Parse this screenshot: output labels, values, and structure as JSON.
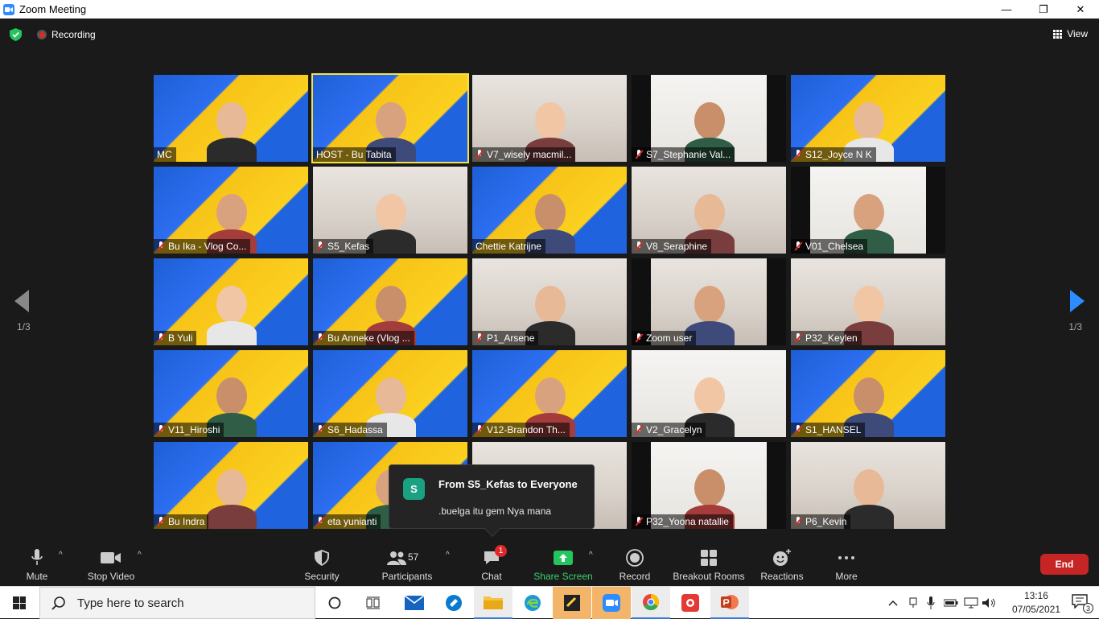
{
  "window": {
    "title": "Zoom Meeting",
    "minimize_label": "—",
    "maximize_label": "❐",
    "close_label": "✕"
  },
  "topbar": {
    "recording_label": "Recording",
    "view_label": "View"
  },
  "pagination": {
    "left_page": "1/3",
    "right_page": "1/3"
  },
  "participants_grid": [
    {
      "name": "MC",
      "muted": false,
      "bg": "petra"
    },
    {
      "name": "HOST - Bu Tabita",
      "muted": false,
      "bg": "petra",
      "active": true
    },
    {
      "name": "V7_wisely macmil...",
      "muted": true,
      "bg": "room"
    },
    {
      "name": "S7_Stephanie Val...",
      "muted": true,
      "bg": "room2"
    },
    {
      "name": "S12_Joyce N K",
      "muted": true,
      "bg": "petra"
    },
    {
      "name": "Bu Ika - Vlog Co...",
      "muted": true,
      "bg": "petra"
    },
    {
      "name": "S5_Kefas",
      "muted": true,
      "bg": "room"
    },
    {
      "name": "Chettie Katrijne",
      "muted": false,
      "bg": "petra"
    },
    {
      "name": "V8_Seraphine",
      "muted": true,
      "bg": "room"
    },
    {
      "name": "V01_Chelsea",
      "muted": true,
      "bg": "room2"
    },
    {
      "name": "B Yuli",
      "muted": true,
      "bg": "petra"
    },
    {
      "name": "Bu Anneke (Vlog ...",
      "muted": true,
      "bg": "petra"
    },
    {
      "name": "P1_Arsene",
      "muted": true,
      "bg": "room"
    },
    {
      "name": "Zoom user",
      "muted": true,
      "bg": "room"
    },
    {
      "name": "P32_Keylen",
      "muted": true,
      "bg": "room"
    },
    {
      "name": "V11_Hiroshi",
      "muted": true,
      "bg": "petra"
    },
    {
      "name": "S6_Hadassa",
      "muted": true,
      "bg": "petra"
    },
    {
      "name": "V12-Brandon Th...",
      "muted": true,
      "bg": "petra"
    },
    {
      "name": "V2_Gracelyn",
      "muted": true,
      "bg": "room2"
    },
    {
      "name": "S1_HANSEL",
      "muted": true,
      "bg": "petra"
    },
    {
      "name": "Bu Indra",
      "muted": true,
      "bg": "petra"
    },
    {
      "name": "eta yunianti",
      "muted": true,
      "bg": "petra"
    },
    {
      "name": "",
      "muted": false,
      "bg": "room"
    },
    {
      "name": "P32_Yoona natallie",
      "muted": true,
      "bg": "room2"
    },
    {
      "name": "P6_Kevin",
      "muted": true,
      "bg": "room"
    }
  ],
  "chat_toast": {
    "avatar_letter": "S",
    "from": "From S5_Kefas to Everyone",
    "message": ".buelga itu gem Nya mana"
  },
  "toolbar": {
    "mute_label": "Mute",
    "stop_video_label": "Stop Video",
    "security_label": "Security",
    "participants_label": "Participants",
    "participants_count": "57",
    "chat_label": "Chat",
    "chat_badge": "1",
    "share_screen_label": "Share Screen",
    "record_label": "Record",
    "breakout_rooms_label": "Breakout Rooms",
    "reactions_label": "Reactions",
    "more_label": "More",
    "end_label": "End"
  },
  "taskbar": {
    "search_placeholder": "Type here to search",
    "time": "13:16",
    "date": "07/05/2021",
    "notification_count": "3"
  },
  "colors": {
    "zoom_blue": "#2d8cff",
    "share_green": "#3ad16c",
    "end_red": "#c52525",
    "active_speaker": "#f4e24a",
    "petra_blue": "#1f63de",
    "petra_yellow": "#fbd01f"
  }
}
